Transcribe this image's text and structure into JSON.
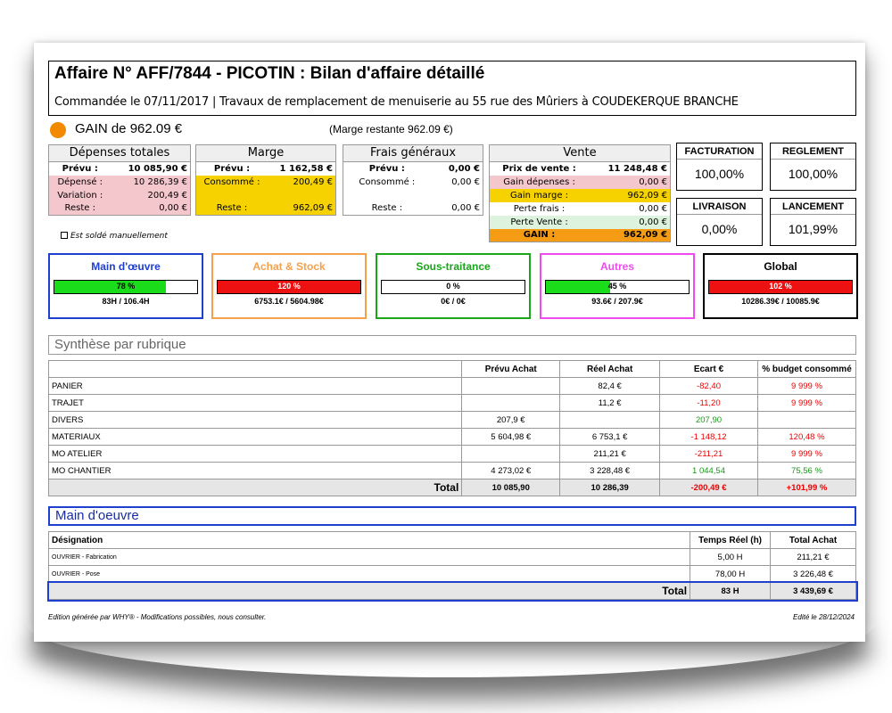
{
  "header": {
    "title": "Affaire N° AFF/7844 - PICOTIN : Bilan d'affaire détaillé",
    "subtitle": "Commandée le 07/11/2017 | Travaux de remplacement de menuiserie au 55 rue des Mûriers à COUDEKERQUE BRANCHE"
  },
  "gain": {
    "text": "GAIN de  962.09 €",
    "marge_restante": "(Marge restante  962.09 €)",
    "dot_color": "#f28a00"
  },
  "depenses": {
    "title": "Dépenses totales",
    "rows": [
      [
        "Prévu :",
        "10 085,90 €"
      ],
      [
        "Dépensé :",
        "10 286,39 €"
      ],
      [
        "Variation :",
        "200,49 €"
      ],
      [
        "Reste :",
        "0,00 €"
      ]
    ]
  },
  "marge": {
    "title": "Marge",
    "rows": [
      [
        "Prévu :",
        "1 162,58 €"
      ],
      [
        "Consommé :",
        "200,49 €"
      ],
      [
        "",
        ""
      ],
      [
        "Reste :",
        "962,09 €"
      ]
    ]
  },
  "frais": {
    "title": "Frais généraux",
    "rows": [
      [
        "Prévu :",
        "0,00 €"
      ],
      [
        "Consommé :",
        "0,00 €"
      ],
      [
        "",
        ""
      ],
      [
        "Reste :",
        "0,00 €"
      ]
    ]
  },
  "vente": {
    "title": "Vente",
    "rows": [
      [
        "Prix de vente :",
        "11 248,48 €"
      ],
      [
        "Gain dépenses :",
        "0,00 €"
      ],
      [
        "Gain marge :",
        "962,09 €"
      ],
      [
        "Perte frais :",
        "0,00 €"
      ],
      [
        "Perte Vente :",
        "0,00 €"
      ],
      [
        "GAIN :",
        "962,09 €"
      ]
    ]
  },
  "kpis": [
    {
      "label": "FACTURATION",
      "value": "100,00%"
    },
    {
      "label": "REGLEMENT",
      "value": "100,00%"
    },
    {
      "label": "LIVRAISON",
      "value": "0,00%"
    },
    {
      "label": "LANCEMENT",
      "value": "101,99%"
    }
  ],
  "solde_label": "Est soldé manuellement",
  "cards": [
    {
      "title": "Main d'œuvre",
      "pct": "78 %",
      "fill": 0.78,
      "value": "83H / 106.4H",
      "color": "#1f3fcf",
      "bar": "#1bdc1b"
    },
    {
      "title": "Achat & Stock",
      "pct": "120 %",
      "fill": 1,
      "value": "6753.1€ / 5604.98€",
      "color": "#f5a04a",
      "bar": "#ee1111"
    },
    {
      "title": "Sous-traitance",
      "pct": "0 %",
      "fill": 0,
      "value": "0€ / 0€",
      "color": "#1aa51a",
      "bar": "#1bdc1b"
    },
    {
      "title": "Autres",
      "pct": "45 %",
      "fill": 0.45,
      "value": "93.6€ / 207.9€",
      "color": "#ee4aee",
      "bar": "#1bdc1b"
    },
    {
      "title": "Global",
      "pct": "102 %",
      "fill": 1,
      "value": "10286.39€ / 10085.9€",
      "color": "#000000",
      "bar": "#ee1111"
    }
  ],
  "synthese": {
    "title": "Synthèse par rubrique",
    "headers": [
      "",
      "Prévu Achat",
      "Réel Achat",
      "Ecart  €",
      "% budget consommé"
    ],
    "rows": [
      [
        "PANIER",
        "",
        "82,4 €",
        "-82,40",
        "9 999 %"
      ],
      [
        "TRAJET",
        "",
        "11,2 €",
        "-11,20",
        "9 999 %"
      ],
      [
        "DIVERS",
        "207,9 €",
        "",
        "207,90",
        ""
      ],
      [
        "MATERIAUX",
        "5 604,98 €",
        "6 753,1 €",
        "-1 148,12",
        "120,48 %"
      ],
      [
        "MO ATELIER",
        "",
        "211,21 €",
        "-211,21",
        "9 999 %"
      ],
      [
        "MO CHANTIER",
        "4 273,02 €",
        "3 228,48 €",
        "1 044,54",
        "75,56 %"
      ]
    ],
    "total": [
      "Total",
      "10 085,90",
      "10 286,39",
      "-200,49 €",
      "+101,99 %"
    ]
  },
  "mo": {
    "title": "Main d'oeuvre",
    "headers": [
      "Désignation",
      "Temps Réel (h)",
      "Total Achat"
    ],
    "rows": [
      [
        "OUVRIER - Fabrication",
        "5,00 H",
        "211,21 €"
      ],
      [
        "OUVRIER - Pose",
        "78,00 H",
        "3 226,48 €"
      ]
    ],
    "total": [
      "Total",
      "83 H",
      "3 439,69 €"
    ]
  },
  "footer": {
    "left": "Edition générée par WHY® - Modifications possibles, nous consulter.",
    "right": "Edité le 28/12/2024"
  }
}
